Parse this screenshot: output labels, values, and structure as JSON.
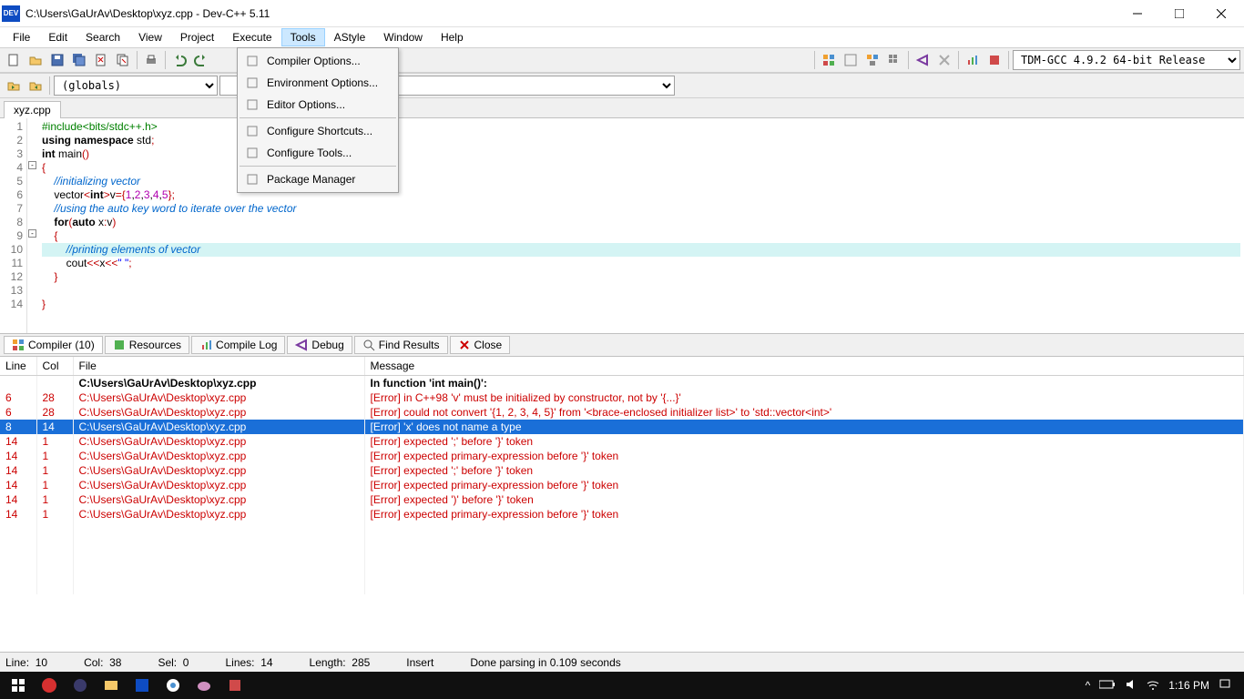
{
  "window": {
    "title": "C:\\Users\\GaUrAv\\Desktop\\xyz.cpp - Dev-C++ 5.11",
    "app_badge": "DEV"
  },
  "menu": [
    "File",
    "Edit",
    "Search",
    "View",
    "Project",
    "Execute",
    "Tools",
    "AStyle",
    "Window",
    "Help"
  ],
  "menu_open_index": 6,
  "tools_menu": [
    "Compiler Options...",
    "Environment Options...",
    "Editor Options...",
    "Configure Shortcuts...",
    "Configure Tools...",
    "Package Manager"
  ],
  "compiler_select": "TDM-GCC 4.9.2 64-bit Release",
  "globals_combo": "(globals)",
  "tab": "xyz.cpp",
  "code_lines": [
    {
      "n": 1,
      "html": "<span class='inc'>#include&lt;bits/stdc++.h&gt;</span>"
    },
    {
      "n": 2,
      "html": "<span class='kw'>using namespace</span> std<span class='op'>;</span>"
    },
    {
      "n": 3,
      "html": "<span class='kw'>int</span> <span class='fn'>main</span><span class='brace'>()</span>"
    },
    {
      "n": 4,
      "html": "<span class='brace'>{</span>",
      "fold": "-"
    },
    {
      "n": 5,
      "html": "&nbsp;&nbsp;&nbsp;&nbsp;<span class='cmt'>//initializing vector</span>"
    },
    {
      "n": 6,
      "html": "&nbsp;&nbsp;&nbsp;&nbsp;vector<span class='op'>&lt;</span><span class='kw'>int</span><span class='op'>&gt;</span>v<span class='op'>=</span><span class='brace'>{</span><span class='num'>1</span>,<span class='num'>2</span>,<span class='num'>3</span>,<span class='num'>4</span>,<span class='num'>5</span><span class='brace'>}</span><span class='op'>;</span>"
    },
    {
      "n": 7,
      "html": "&nbsp;&nbsp;&nbsp;&nbsp;<span class='cmt'>//using the auto key word to iterate over the vector</span>"
    },
    {
      "n": 8,
      "html": "&nbsp;&nbsp;&nbsp;&nbsp;<span class='kw'>for</span><span class='brace'>(</span><span class='kw'>auto</span> x<span class='op'>:</span>v<span class='brace'>)</span>"
    },
    {
      "n": 9,
      "html": "&nbsp;&nbsp;&nbsp;&nbsp;<span class='brace'>{</span>",
      "fold": "-"
    },
    {
      "n": 10,
      "html": "&nbsp;&nbsp;&nbsp;&nbsp;&nbsp;&nbsp;&nbsp;&nbsp;<span class='cmt'>//printing elements of vector</span>",
      "hl": true
    },
    {
      "n": 11,
      "html": "&nbsp;&nbsp;&nbsp;&nbsp;&nbsp;&nbsp;&nbsp;&nbsp;cout<span class='op'>&lt;&lt;</span>x<span class='op'>&lt;&lt;</span><span class='str'>\" \"</span><span class='op'>;</span>"
    },
    {
      "n": 12,
      "html": "&nbsp;&nbsp;&nbsp;&nbsp;<span class='brace'>}</span>"
    },
    {
      "n": 13,
      "html": ""
    },
    {
      "n": 14,
      "html": "<span class='brace'>}</span>"
    }
  ],
  "panel_tabs": [
    {
      "label": "Compiler (10)",
      "active": true
    },
    {
      "label": "Resources"
    },
    {
      "label": "Compile Log"
    },
    {
      "label": "Debug"
    },
    {
      "label": "Find Results"
    },
    {
      "label": "Close"
    }
  ],
  "grid_headers": [
    "Line",
    "Col",
    "File",
    "Message"
  ],
  "grid_rows": [
    {
      "line": "",
      "col": "",
      "file": "C:\\Users\\GaUrAv\\Desktop\\xyz.cpp",
      "msg": "In function 'int main()':",
      "cls": "hdr2"
    },
    {
      "line": "6",
      "col": "28",
      "file": "C:\\Users\\GaUrAv\\Desktop\\xyz.cpp",
      "msg": "[Error] in C++98 'v' must be initialized by constructor, not by '{...}'",
      "cls": "err"
    },
    {
      "line": "6",
      "col": "28",
      "file": "C:\\Users\\GaUrAv\\Desktop\\xyz.cpp",
      "msg": "[Error] could not convert '{1, 2, 3, 4, 5}' from '<brace-enclosed initializer list>' to 'std::vector<int>'",
      "cls": "err"
    },
    {
      "line": "8",
      "col": "14",
      "file": "C:\\Users\\GaUrAv\\Desktop\\xyz.cpp",
      "msg": "[Error] 'x' does not name a type",
      "cls": "sel"
    },
    {
      "line": "14",
      "col": "1",
      "file": "C:\\Users\\GaUrAv\\Desktop\\xyz.cpp",
      "msg": "[Error] expected ';' before '}' token",
      "cls": "err"
    },
    {
      "line": "14",
      "col": "1",
      "file": "C:\\Users\\GaUrAv\\Desktop\\xyz.cpp",
      "msg": "[Error] expected primary-expression before '}' token",
      "cls": "err"
    },
    {
      "line": "14",
      "col": "1",
      "file": "C:\\Users\\GaUrAv\\Desktop\\xyz.cpp",
      "msg": "[Error] expected ';' before '}' token",
      "cls": "err"
    },
    {
      "line": "14",
      "col": "1",
      "file": "C:\\Users\\GaUrAv\\Desktop\\xyz.cpp",
      "msg": "[Error] expected primary-expression before '}' token",
      "cls": "err"
    },
    {
      "line": "14",
      "col": "1",
      "file": "C:\\Users\\GaUrAv\\Desktop\\xyz.cpp",
      "msg": "[Error] expected ')' before '}' token",
      "cls": "err"
    },
    {
      "line": "14",
      "col": "1",
      "file": "C:\\Users\\GaUrAv\\Desktop\\xyz.cpp",
      "msg": "[Error] expected primary-expression before '}' token",
      "cls": "err"
    }
  ],
  "status": {
    "line_lbl": "Line:",
    "line": "10",
    "col_lbl": "Col:",
    "col": "38",
    "sel_lbl": "Sel:",
    "sel": "0",
    "lines_lbl": "Lines:",
    "lines": "14",
    "length_lbl": "Length:",
    "length": "285",
    "mode": "Insert",
    "parse": "Done parsing in 0.109 seconds"
  },
  "taskbar": {
    "time": "1:16 PM"
  }
}
